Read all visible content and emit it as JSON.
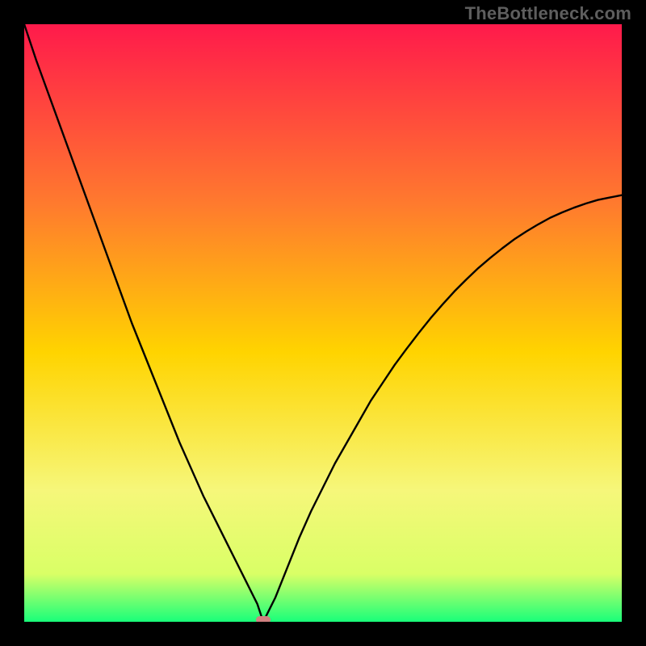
{
  "watermark": "TheBottleneck.com",
  "chart_data": {
    "type": "line",
    "title": "",
    "xlabel": "",
    "ylabel": "",
    "xlim": [
      0,
      100
    ],
    "ylim": [
      0,
      100
    ],
    "grid": false,
    "legend": false,
    "description": "Bottleneck percentage curve. X-axis represents a swept component score; Y-axis is bottleneck percentage. Background is a vertical rainbow gradient from red (top = high bottleneck) to green (bottom = 0%).",
    "minimum_x": 40,
    "gradient_stops": [
      {
        "offset": 0.0,
        "color": "#ff1a4b"
      },
      {
        "offset": 0.3,
        "color": "#ff7a2e"
      },
      {
        "offset": 0.55,
        "color": "#ffd400"
      },
      {
        "offset": 0.78,
        "color": "#f6f77a"
      },
      {
        "offset": 0.92,
        "color": "#d9ff66"
      },
      {
        "offset": 1.0,
        "color": "#19ff7a"
      }
    ],
    "x": [
      0,
      2,
      4,
      6,
      8,
      10,
      12,
      14,
      16,
      18,
      20,
      22,
      24,
      26,
      28,
      30,
      32,
      34,
      36,
      37,
      38,
      39,
      40,
      41,
      42,
      43,
      44,
      46,
      48,
      50,
      52,
      54,
      56,
      58,
      60,
      62,
      64,
      66,
      68,
      70,
      72,
      74,
      76,
      78,
      80,
      82,
      84,
      86,
      88,
      90,
      92,
      94,
      96,
      98,
      100
    ],
    "y_percent": [
      100,
      94,
      88.5,
      83,
      77.5,
      72,
      66.5,
      61,
      55.5,
      50,
      45,
      40,
      35,
      30,
      25.5,
      21,
      17,
      13,
      9,
      7,
      5,
      3,
      0,
      2,
      4,
      6.5,
      9,
      14,
      18.5,
      22.5,
      26.5,
      30,
      33.5,
      37,
      40,
      43,
      45.7,
      48.3,
      50.8,
      53.1,
      55.3,
      57.3,
      59.2,
      60.9,
      62.5,
      64,
      65.3,
      66.5,
      67.6,
      68.5,
      69.3,
      70,
      70.6,
      71,
      71.4
    ],
    "marker": {
      "x": 40,
      "y_percent": 0,
      "color": "#d08080",
      "shape": "rounded-rect"
    }
  }
}
